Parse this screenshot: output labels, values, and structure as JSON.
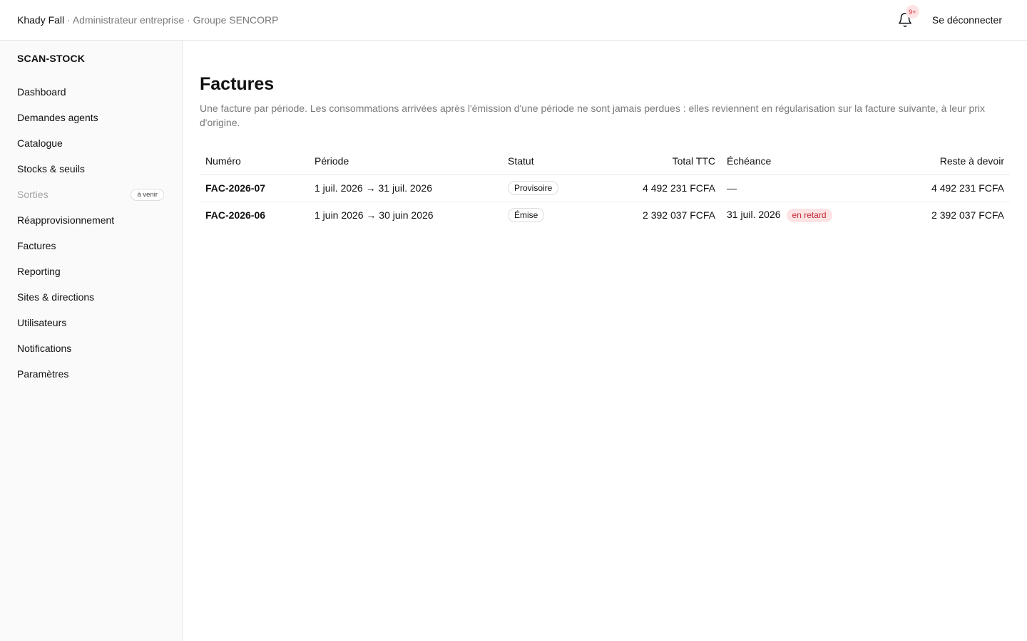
{
  "header": {
    "user_name": "Khady Fall",
    "user_context": " · Administrateur entreprise · Groupe SENCORP",
    "notifications_badge": "9+",
    "logout_label": "Se déconnecter"
  },
  "sidebar": {
    "brand": "SCAN-STOCK",
    "items": [
      {
        "label": "Dashboard",
        "disabled": false
      },
      {
        "label": "Demandes agents",
        "disabled": false
      },
      {
        "label": "Catalogue",
        "disabled": false
      },
      {
        "label": "Stocks & seuils",
        "disabled": false
      },
      {
        "label": "Sorties",
        "disabled": true,
        "badge": "à venir"
      },
      {
        "label": "Réapprovisionnement",
        "disabled": false
      },
      {
        "label": "Factures",
        "disabled": false
      },
      {
        "label": "Reporting",
        "disabled": false
      },
      {
        "label": "Sites & directions",
        "disabled": false
      },
      {
        "label": "Utilisateurs",
        "disabled": false
      },
      {
        "label": "Notifications",
        "disabled": false
      },
      {
        "label": "Paramètres",
        "disabled": false
      }
    ]
  },
  "main": {
    "title": "Factures",
    "subtitle": "Une facture par période. Les consommations arrivées après l'émission d'une période ne sont jamais perdues : elles reviennent en régularisation sur la facture suivante, à leur prix d'origine.",
    "table": {
      "columns": [
        "Numéro",
        "Période",
        "Statut",
        "Total TTC",
        "Échéance",
        "Reste à devoir"
      ],
      "rows": [
        {
          "number": "FAC-2026-07",
          "period": "1 juil. 2026 → 31 juil. 2026",
          "status": "Provisoire",
          "total": "4 492 231 FCFA",
          "due": "—",
          "late": "",
          "remaining": "4 492 231 FCFA"
        },
        {
          "number": "FAC-2026-06",
          "period": "1 juin 2026 → 30 juin 2026",
          "status": "Émise",
          "total": "2 392 037 FCFA",
          "due": "31 juil. 2026",
          "late": "en retard",
          "remaining": "2 392 037 FCFA"
        }
      ]
    }
  },
  "icons": {
    "bell": "bell-icon"
  },
  "colors": {
    "badge_background": "#fde3e4",
    "badge_text": "#c62a36",
    "muted_text": "#7a7a7a",
    "sidebar_background": "#fafafa"
  }
}
